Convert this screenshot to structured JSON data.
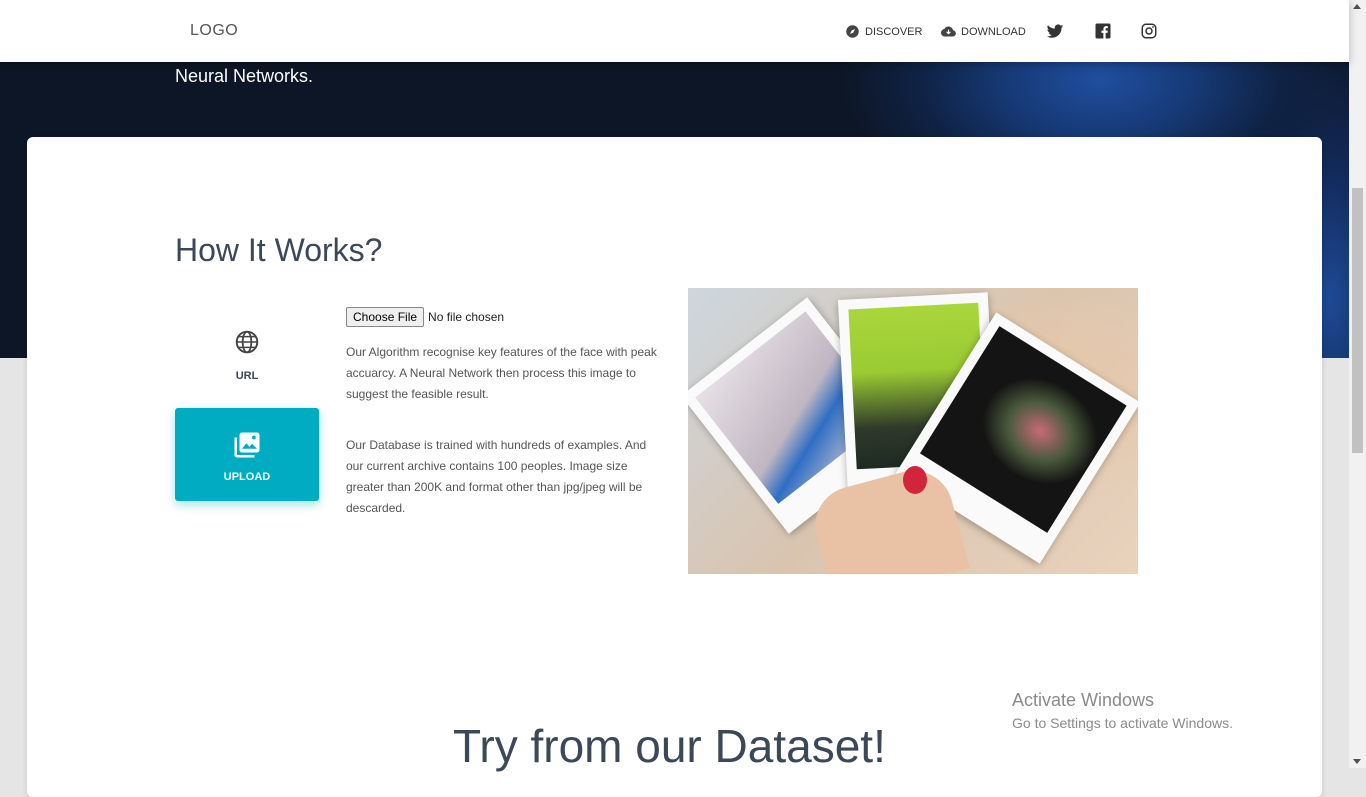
{
  "hero": {
    "subtitle": "Neural Networks."
  },
  "navbar": {
    "logo": "LOGO",
    "links": [
      {
        "label": "DISCOVER",
        "icon": "compass-icon"
      },
      {
        "label": "DOWNLOAD",
        "icon": "cloud-download-icon"
      }
    ],
    "social": [
      "twitter-icon",
      "facebook-icon",
      "instagram-icon"
    ]
  },
  "how_it_works": {
    "title": "How It Works?",
    "tabs": [
      {
        "label": "URL",
        "icon": "globe-icon",
        "active": false
      },
      {
        "label": "UPLOAD",
        "icon": "photo-library-icon",
        "active": true
      }
    ],
    "file_input": {
      "button": "Choose File",
      "status": "No file chosen"
    },
    "paragraphs": [
      "Our Algorithm recognise key features of the face with peak accuarcy. A Neural Network then process this image to suggest the feasible result.",
      "Our Database is trained with hundreds of examples. And our current archive contains 100 peoples. Image size greater than 200K and format other than jpg/jpeg will be descarded."
    ]
  },
  "dataset": {
    "title": "Try from our Dataset!"
  },
  "windows_watermark": {
    "line1": "Activate Windows",
    "line2": "Go to Settings to activate Windows."
  },
  "colors": {
    "accent": "#00acc1",
    "hero_bg": "#0d1626",
    "text": "#3c4858"
  }
}
